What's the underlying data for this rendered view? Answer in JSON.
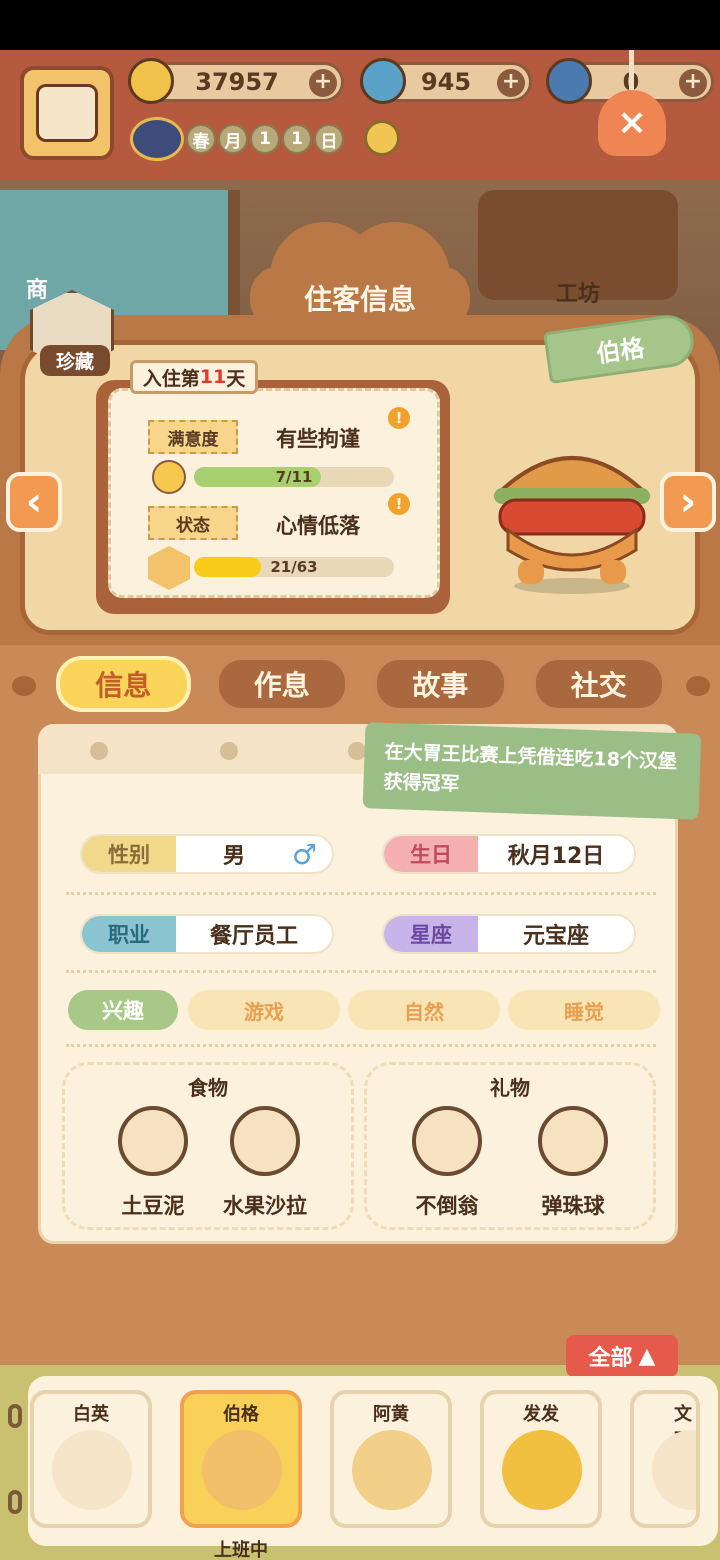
{
  "hud": {
    "currency_1": "37957",
    "currency_2": "945",
    "currency_3": "0",
    "season": [
      "春",
      "月",
      "1",
      "1",
      "日"
    ],
    "bell_icon": "×"
  },
  "scene": {
    "shop_label": "商",
    "workshop_label": "工坊"
  },
  "panel": {
    "title": "住客信息",
    "treasure_label": "珍藏",
    "resident_name": "伯格",
    "arrow_left": "‹",
    "arrow_right": "›",
    "day_prefix": "入住第",
    "day_number": "11",
    "day_suffix": "天",
    "satisfaction": {
      "label": "满意度",
      "value": "有些拘谨",
      "progress_text": "7/11",
      "fraction": 0.636
    },
    "status": {
      "label": "状态",
      "value": "心情低落",
      "progress_text": "21/63",
      "fraction": 0.333
    }
  },
  "tabs": [
    "信息",
    "作息",
    "故事",
    "社交"
  ],
  "info": {
    "note": "在大胃王比赛上凭借连吃18个汉堡获得冠军",
    "gender": {
      "label": "性别",
      "value": "男",
      "icon": "♂"
    },
    "birthday": {
      "label": "生日",
      "value": "秋月12日"
    },
    "job": {
      "label": "职业",
      "value": "餐厅员工"
    },
    "zodiac": {
      "label": "星座",
      "value": "元宝座",
      "icon": "♏"
    },
    "hobby_label": "兴趣",
    "hobbies": [
      "游戏",
      "自然",
      "睡觉"
    ],
    "food_title": "食物",
    "foods": [
      "土豆泥",
      "水果沙拉"
    ],
    "gift_title": "礼物",
    "gifts": [
      "不倒翁",
      "弹珠球"
    ]
  },
  "roster": {
    "all_button": "全部",
    "residents": [
      {
        "name": "白英",
        "status": ""
      },
      {
        "name": "伯格",
        "status": "上班中"
      },
      {
        "name": "阿黄",
        "status": ""
      },
      {
        "name": "发发",
        "status": ""
      },
      {
        "name": "文西",
        "status": ""
      }
    ]
  },
  "colors": {
    "accent": "#fbd45a",
    "panel": "#b97845",
    "green": "#9bbd86"
  }
}
